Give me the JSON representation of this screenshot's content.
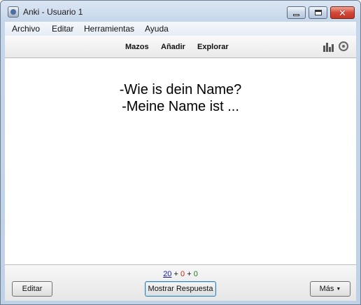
{
  "window": {
    "title": "Anki - Usuario 1",
    "close_symbol": "✕"
  },
  "menu": {
    "items": [
      "Archivo",
      "Editar",
      "Herramientas",
      "Ayuda"
    ]
  },
  "toolbar": {
    "links": [
      "Mazos",
      "Añadir",
      "Explorar"
    ],
    "icons": [
      "stats-icon",
      "sync-icon"
    ]
  },
  "card": {
    "lines": [
      "-Wie is dein Name?",
      "-Meine Name ist ..."
    ]
  },
  "counts": {
    "new": "20",
    "learning": "0",
    "review": "0",
    "separator": "+",
    "colors": {
      "new": "#1a1aa8",
      "learning": "#c0281c",
      "review": "#1f7a1f"
    }
  },
  "buttons": {
    "edit": "Editar",
    "show_answer": "Mostrar Respuesta",
    "more": "Más",
    "more_caret": "▼"
  }
}
